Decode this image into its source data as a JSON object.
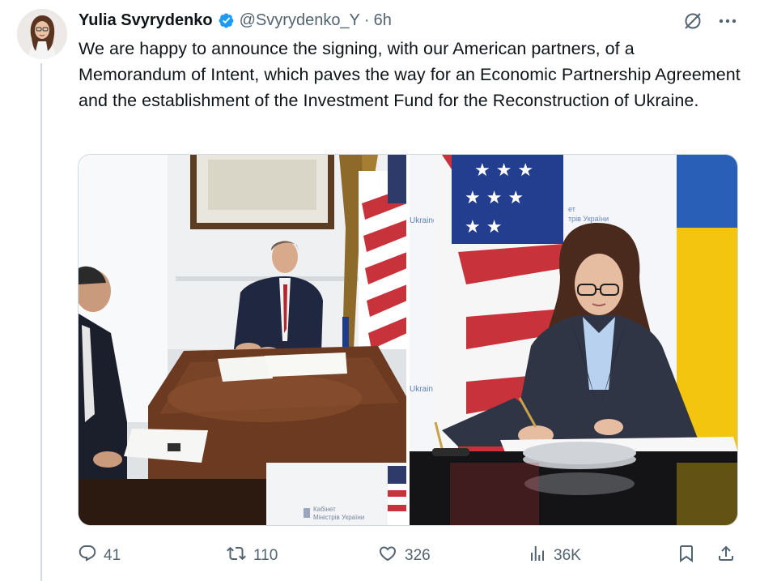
{
  "tweet": {
    "author_name": "Yulia Svyrydenko",
    "handle": "@Svyrydenko_Y",
    "separator": "·",
    "time": "6h",
    "verified": true,
    "text": "We are happy to announce the signing, with our American partners, of a Memorandum of Intent, which paves the way for an Economic Partnership Agreement and the establishment of the Investment Fund for the Reconstruction of Ukraine.",
    "photo_captions": {
      "left_nameplate_line1": "Кабінет",
      "left_nameplate_line2": "Міністрів України",
      "right_banner_line1": "ет",
      "right_banner_line2": "трів України",
      "right_banner_side": "Ukraine",
      "right_banner_side_lower": "Ukrain"
    }
  },
  "actions": {
    "replies": "41",
    "retweets": "110",
    "likes": "326",
    "views": "36K"
  },
  "colors": {
    "text_primary": "#0f1419",
    "text_secondary": "#536471",
    "verified_blue": "#1d9bf0",
    "border": "#cfd9de",
    "flag_ukraine_blue": "#2a5fb8",
    "flag_ukraine_yellow": "#f3c50f"
  },
  "icons": {
    "verified": "verified-badge-icon",
    "grok": "grok-icon",
    "more": "more-dots-icon",
    "reply": "reply-icon",
    "retweet": "retweet-icon",
    "like": "heart-icon",
    "views": "views-chart-icon",
    "bookmark": "bookmark-icon",
    "share": "share-icon"
  }
}
